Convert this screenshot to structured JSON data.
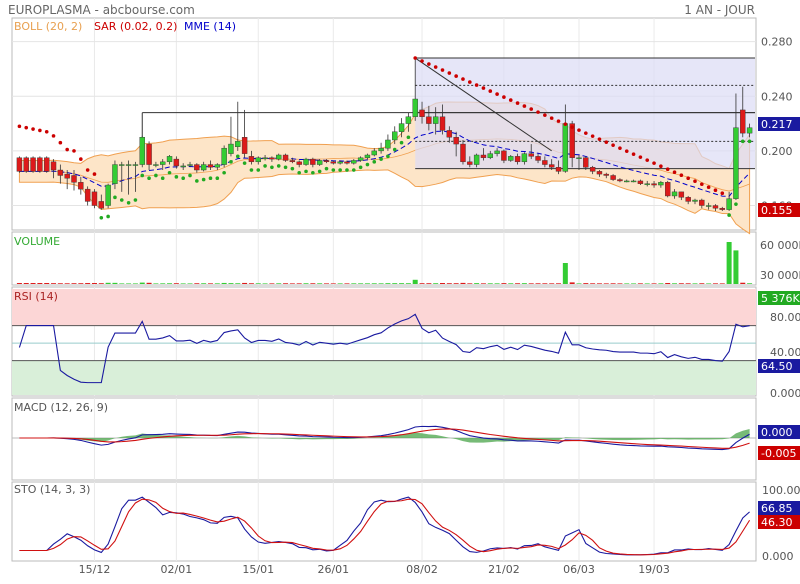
{
  "header": {
    "title": "EUROPLASMA - abcbourse.com",
    "period": "1 AN - JOUR"
  },
  "colors": {
    "up": "#33cc33",
    "down": "#dd1a1a",
    "boll_fill": "#fde5c8",
    "boll_line": "#f0a050",
    "sar": "#cc0000",
    "sar_up": "#22aa22",
    "mme": "#0000cc",
    "rsi_over": "#fcd6d6",
    "rsi_under": "#d9efd9",
    "line_blue": "#1a1aa0",
    "line_red": "#d01010",
    "hist": "#55aa55",
    "fib_fill": "#dcdcf5"
  },
  "chart_data": [
    {
      "type": "candlestick",
      "name": "price",
      "legend": [
        {
          "label": "BOLL (20, 2)",
          "color": "#e8a050"
        },
        {
          "label": "SAR (0.02, 0.2)",
          "color": "#cc0000"
        },
        {
          "label": "MME (14)",
          "color": "#0000cc"
        }
      ],
      "y_ticks": [
        "0.280",
        "0.240",
        "0.200",
        "0.160"
      ],
      "ylim": [
        0.145,
        0.29
      ],
      "last_price": "0.217",
      "low_label": "0.155",
      "x_ticks": [
        "15/12",
        "02/01",
        "15/01",
        "26/01",
        "08/02",
        "21/02",
        "06/03",
        "19/03"
      ],
      "x_tick_index": [
        11,
        23,
        35,
        46,
        59,
        71,
        82,
        93
      ],
      "candles": [
        [
          0.195,
          0.185,
          0.196,
          0.184
        ],
        [
          0.195,
          0.185,
          0.196,
          0.184
        ],
        [
          0.195,
          0.185,
          0.196,
          0.184
        ],
        [
          0.195,
          0.185,
          0.196,
          0.184
        ],
        [
          0.195,
          0.185,
          0.196,
          0.184
        ],
        [
          0.192,
          0.186,
          0.194,
          0.18
        ],
        [
          0.186,
          0.182,
          0.19,
          0.176
        ],
        [
          0.183,
          0.18,
          0.186,
          0.172
        ],
        [
          0.182,
          0.177,
          0.186,
          0.171
        ],
        [
          0.177,
          0.172,
          0.181,
          0.168
        ],
        [
          0.172,
          0.163,
          0.174,
          0.16
        ],
        [
          0.17,
          0.16,
          0.172,
          0.158
        ],
        [
          0.163,
          0.158,
          0.168,
          0.157
        ],
        [
          0.16,
          0.175,
          0.176,
          0.158
        ],
        [
          0.176,
          0.19,
          0.193,
          0.172
        ],
        [
          0.19,
          0.19,
          0.192,
          0.17
        ],
        [
          0.19,
          0.19,
          0.193,
          0.168
        ],
        [
          0.19,
          0.19,
          0.192,
          0.17
        ],
        [
          0.19,
          0.21,
          0.211,
          0.188
        ],
        [
          0.205,
          0.19,
          0.207,
          0.186
        ],
        [
          0.19,
          0.19,
          0.192,
          0.188
        ],
        [
          0.19,
          0.192,
          0.194,
          0.186
        ],
        [
          0.192,
          0.196,
          0.197,
          0.19
        ],
        [
          0.194,
          0.189,
          0.196,
          0.187
        ],
        [
          0.189,
          0.189,
          0.191,
          0.186
        ],
        [
          0.19,
          0.19,
          0.192,
          0.188
        ],
        [
          0.19,
          0.186,
          0.191,
          0.184
        ],
        [
          0.186,
          0.19,
          0.192,
          0.185
        ],
        [
          0.19,
          0.188,
          0.193,
          0.186
        ],
        [
          0.188,
          0.19,
          0.191,
          0.186
        ],
        [
          0.19,
          0.202,
          0.204,
          0.188
        ],
        [
          0.198,
          0.205,
          0.225,
          0.196
        ],
        [
          0.203,
          0.207,
          0.236,
          0.2
        ],
        [
          0.21,
          0.198,
          0.23,
          0.195
        ],
        [
          0.196,
          0.192,
          0.2,
          0.19
        ],
        [
          0.192,
          0.195,
          0.196,
          0.19
        ],
        [
          0.195,
          0.195,
          0.197,
          0.193
        ],
        [
          0.195,
          0.194,
          0.196,
          0.192
        ],
        [
          0.194,
          0.197,
          0.198,
          0.193
        ],
        [
          0.197,
          0.193,
          0.198,
          0.192
        ],
        [
          0.193,
          0.192,
          0.195,
          0.191
        ],
        [
          0.192,
          0.19,
          0.193,
          0.188
        ],
        [
          0.19,
          0.194,
          0.195,
          0.189
        ],
        [
          0.194,
          0.19,
          0.195,
          0.188
        ],
        [
          0.19,
          0.193,
          0.194,
          0.189
        ],
        [
          0.193,
          0.192,
          0.194,
          0.191
        ],
        [
          0.192,
          0.191,
          0.193,
          0.19
        ],
        [
          0.191,
          0.192,
          0.193,
          0.19
        ],
        [
          0.192,
          0.191,
          0.193,
          0.19
        ],
        [
          0.191,
          0.193,
          0.194,
          0.19
        ],
        [
          0.193,
          0.195,
          0.196,
          0.192
        ],
        [
          0.195,
          0.197,
          0.198,
          0.194
        ],
        [
          0.197,
          0.2,
          0.202,
          0.196
        ],
        [
          0.2,
          0.202,
          0.206,
          0.198
        ],
        [
          0.202,
          0.208,
          0.212,
          0.2
        ],
        [
          0.208,
          0.214,
          0.218,
          0.205
        ],
        [
          0.214,
          0.22,
          0.224,
          0.21
        ],
        [
          0.22,
          0.225,
          0.228,
          0.214
        ],
        [
          0.225,
          0.238,
          0.267,
          0.222
        ],
        [
          0.23,
          0.225,
          0.236,
          0.22
        ],
        [
          0.225,
          0.22,
          0.233,
          0.215
        ],
        [
          0.22,
          0.225,
          0.232,
          0.212
        ],
        [
          0.225,
          0.215,
          0.234,
          0.212
        ],
        [
          0.215,
          0.21,
          0.218,
          0.206
        ],
        [
          0.21,
          0.205,
          0.214,
          0.196
        ],
        [
          0.205,
          0.192,
          0.208,
          0.19
        ],
        [
          0.192,
          0.19,
          0.196,
          0.188
        ],
        [
          0.19,
          0.197,
          0.198,
          0.188
        ],
        [
          0.197,
          0.195,
          0.202,
          0.193
        ],
        [
          0.195,
          0.198,
          0.2,
          0.194
        ],
        [
          0.198,
          0.2,
          0.202,
          0.196
        ],
        [
          0.2,
          0.193,
          0.201,
          0.191
        ],
        [
          0.193,
          0.196,
          0.197,
          0.192
        ],
        [
          0.196,
          0.192,
          0.198,
          0.19
        ],
        [
          0.192,
          0.198,
          0.199,
          0.19
        ],
        [
          0.198,
          0.196,
          0.205,
          0.194
        ],
        [
          0.196,
          0.193,
          0.198,
          0.191
        ],
        [
          0.193,
          0.19,
          0.196,
          0.188
        ],
        [
          0.19,
          0.188,
          0.194,
          0.186
        ],
        [
          0.188,
          0.185,
          0.193,
          0.183
        ],
        [
          0.185,
          0.22,
          0.234,
          0.184
        ],
        [
          0.22,
          0.195,
          0.222,
          0.188
        ],
        [
          0.195,
          0.195,
          0.197,
          0.186
        ],
        [
          0.195,
          0.188,
          0.196,
          0.186
        ],
        [
          0.188,
          0.185,
          0.189,
          0.183
        ],
        [
          0.185,
          0.183,
          0.186,
          0.181
        ],
        [
          0.183,
          0.182,
          0.184,
          0.18
        ],
        [
          0.182,
          0.179,
          0.183,
          0.178
        ],
        [
          0.179,
          0.178,
          0.18,
          0.177
        ],
        [
          0.178,
          0.178,
          0.179,
          0.177
        ],
        [
          0.178,
          0.178,
          0.179,
          0.177
        ],
        [
          0.178,
          0.176,
          0.179,
          0.175
        ],
        [
          0.176,
          0.176,
          0.178,
          0.174
        ],
        [
          0.176,
          0.175,
          0.178,
          0.173
        ],
        [
          0.175,
          0.177,
          0.178,
          0.173
        ],
        [
          0.177,
          0.167,
          0.178,
          0.166
        ],
        [
          0.167,
          0.17,
          0.172,
          0.165
        ],
        [
          0.17,
          0.166,
          0.17,
          0.164
        ],
        [
          0.166,
          0.163,
          0.167,
          0.161
        ],
        [
          0.163,
          0.164,
          0.165,
          0.161
        ],
        [
          0.164,
          0.16,
          0.165,
          0.158
        ],
        [
          0.16,
          0.16,
          0.162,
          0.157
        ],
        [
          0.16,
          0.158,
          0.161,
          0.156
        ],
        [
          0.158,
          0.157,
          0.159,
          0.156
        ],
        [
          0.157,
          0.165,
          0.17,
          0.156
        ],
        [
          0.165,
          0.217,
          0.242,
          0.164
        ],
        [
          0.23,
          0.213,
          0.247,
          0.21
        ],
        [
          0.213,
          0.217,
          0.22,
          0.21
        ]
      ]
    },
    {
      "type": "bar",
      "name": "volume",
      "label": "VOLUME",
      "y_ticks": [
        "60 000K",
        "30 000K",
        "0.000K"
      ],
      "ylim": [
        0,
        60000
      ],
      "last_value": "5 376K"
    },
    {
      "type": "line",
      "name": "rsi",
      "label": "RSI (14)",
      "y_ticks": [
        "80.00",
        "40.00",
        "0.000"
      ],
      "ylim": [
        0,
        100
      ],
      "last_value": "64.50"
    },
    {
      "type": "line",
      "name": "macd",
      "label": "MACD (12, 26, 9)",
      "last_values": [
        "0.000",
        "-0.005"
      ]
    },
    {
      "type": "line",
      "name": "sto",
      "label": "STO (14, 3, 3)",
      "y_ticks": [
        "100.00",
        "50.00",
        "0.000"
      ],
      "ylim": [
        0,
        100
      ],
      "last_values": [
        "66.85",
        "46.30"
      ]
    }
  ]
}
